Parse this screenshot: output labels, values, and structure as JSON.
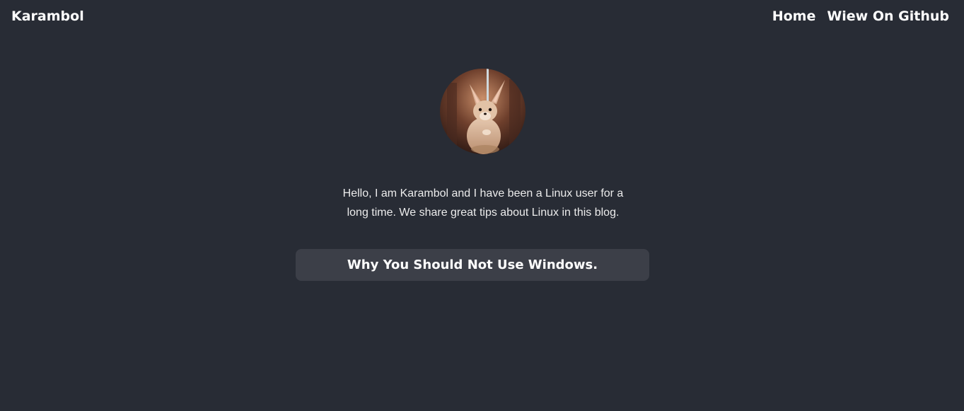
{
  "header": {
    "brand": "Karambol",
    "nav": [
      {
        "label": "Home"
      },
      {
        "label": "Wiew On Github"
      }
    ]
  },
  "profile": {
    "avatar_icon": "fennec-fox-avatar",
    "bio": "Hello, I am Karambol and I have been a Linux user for a long time. We share great tips about Linux in this blog."
  },
  "posts": [
    {
      "title": "Why You Should Not Use Windows."
    }
  ],
  "colors": {
    "background": "#282c35",
    "card": "#3c3f48",
    "text": "#ffffff"
  }
}
